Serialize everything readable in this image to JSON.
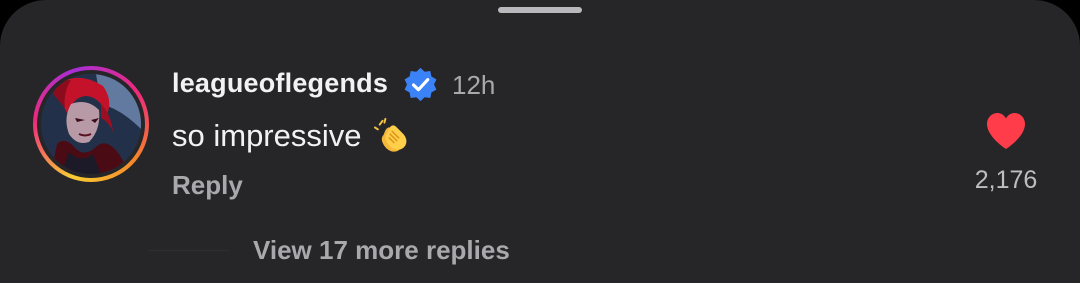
{
  "comment": {
    "username": "leagueoflegends",
    "verified_icon": "verified-badge-icon",
    "time": "12h",
    "text": "so impressive",
    "emoji_icon": "clapping-hands-icon",
    "reply_label": "Reply",
    "like_icon": "heart-icon",
    "like_count": "2,176",
    "view_more_label": "View 17 more replies"
  },
  "colors": {
    "background": "#262629",
    "primary_text": "#f2f2f2",
    "secondary_text": "#a8a8ad",
    "verified_blue": "#3b82f6",
    "heart_red": "#fe3c4a"
  }
}
